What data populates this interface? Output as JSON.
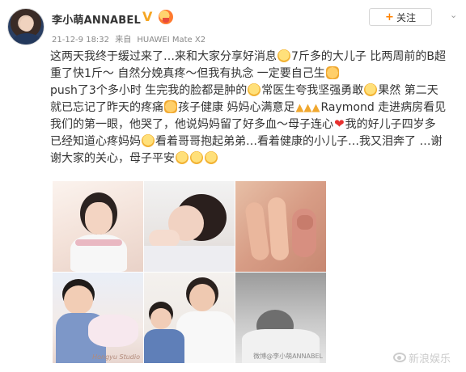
{
  "header": {
    "username": "李小萌ANNABEL",
    "verified_badge": "V",
    "timestamp": "21-12-9 18:32",
    "source_prefix": "来自",
    "source_device": "HUAWEI Mate X2",
    "follow_label": "关注",
    "follow_plus": "+"
  },
  "post": {
    "line1": "这两天我终于缓过来了…来和大家分享好消息",
    "line1b": "7斤多的大儿子 比两周前的B超重了快1斤～ 自然分娩真疼～但我有执念 一定要自己生",
    "line2": "push了3个多小时 生完我的脸都是肿的",
    "line2b": "常医生夸我坚强勇敢",
    "line2c": "果然 第二天就已忘记了昨天的疼痛",
    "line2d": "孩子健康 妈妈心满意足",
    "line2e": "Raymond 走进病房看见我们的第一眼，他哭了，他说妈妈留了好多血～母子连心",
    "line2f": "我的好儿子四岁多已经知道心疼妈妈",
    "line2g": "看着哥哥抱起弟弟…看着健康的小儿子…我又泪奔了 …谢谢大家的关心，母子平安"
  },
  "photos": {
    "p4_watermark": "Hongyu Studio",
    "p6_watermark": "微博@李小萌ANNABEL"
  },
  "footer": {
    "watermark_text": "新浪娱乐"
  },
  "icons": {
    "avatar": "profile-photo",
    "verified": "verified-v-badge-icon",
    "medal": "medal-icon",
    "menu": "chevron-down-icon",
    "weibo": "weibo-eye-icon"
  },
  "colors": {
    "accent": "#ff8200",
    "verified": "#f5a623",
    "heart": "#e8312f"
  }
}
